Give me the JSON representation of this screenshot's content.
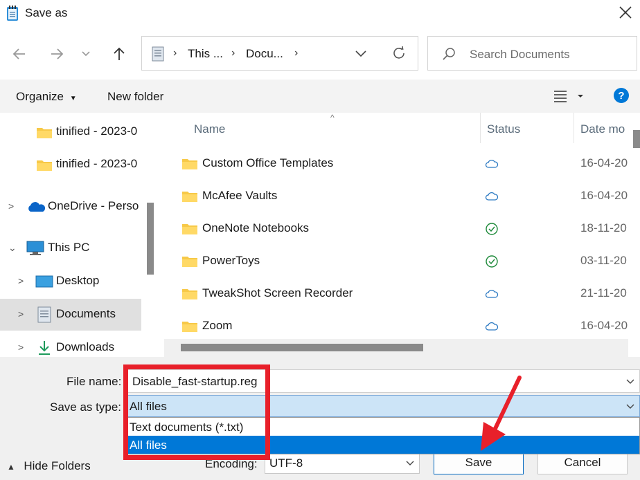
{
  "window": {
    "title": "Save as"
  },
  "address": {
    "crumbs": [
      "This ...",
      "Docu..."
    ]
  },
  "search": {
    "placeholder": "Search Documents"
  },
  "toolbar": {
    "organize": "Organize",
    "new_folder": "New folder"
  },
  "nav": {
    "items": [
      {
        "label": "tinified - 2023-0",
        "icon": "folder-icon"
      },
      {
        "label": "tinified - 2023-0",
        "icon": "folder-icon"
      },
      {
        "label": "OneDrive - Perso",
        "icon": "onedrive-cloud-icon"
      },
      {
        "label": "This PC",
        "icon": "computer-icon"
      },
      {
        "label": "Desktop",
        "icon": "desktop-icon"
      },
      {
        "label": "Documents",
        "icon": "documents-icon",
        "selected": true
      },
      {
        "label": "Downloads",
        "icon": "download-arrow-icon"
      }
    ]
  },
  "columns": {
    "name": "Name",
    "status": "Status",
    "date": "Date mo"
  },
  "files": [
    {
      "name": "Custom Office Templates",
      "status": "cloud-icon",
      "date": "16-04-20"
    },
    {
      "name": "McAfee Vaults",
      "status": "cloud-icon",
      "date": "16-04-20"
    },
    {
      "name": "OneNote Notebooks",
      "status": "synced-check-icon",
      "date": "18-11-20"
    },
    {
      "name": "PowerToys",
      "status": "synced-check-icon",
      "date": "03-11-20"
    },
    {
      "name": "TweakShot Screen Recorder",
      "status": "cloud-icon",
      "date": "21-11-20"
    },
    {
      "name": "Zoom",
      "status": "cloud-icon",
      "date": "16-04-20"
    }
  ],
  "form": {
    "file_name_label": "File name:",
    "file_name_value": "Disable_fast-startup.reg",
    "save_type_label": "Save as type:",
    "save_type_value": "All files",
    "type_options": [
      "Text documents (*.txt)",
      "All files"
    ],
    "encoding_label": "Encoding:",
    "encoding_value": "UTF-8"
  },
  "footer": {
    "hide_folders": "Hide Folders",
    "save": "Save",
    "cancel": "Cancel"
  },
  "colors": {
    "accent": "#0078d7",
    "annotation": "#e8202a",
    "folder": "#f7c948"
  }
}
